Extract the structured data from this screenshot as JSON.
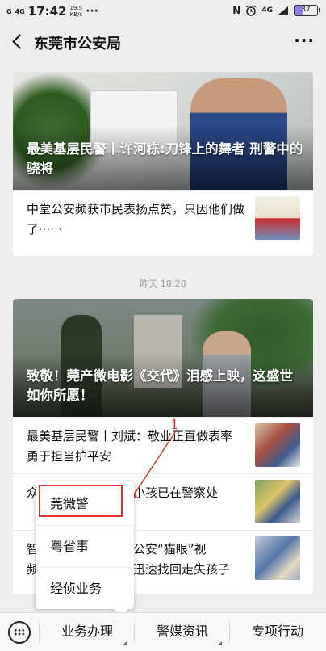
{
  "status_bar": {
    "signal1": "G",
    "signal2": "4G",
    "time": "17:42",
    "speed_value": "19.5",
    "speed_unit": "KB/s",
    "dots": "···",
    "nfc": "N",
    "network": "4G",
    "battery": "37",
    "battery_level": 0.37
  },
  "nav": {
    "title": "东莞市公安局",
    "more": "···"
  },
  "feed": [
    {
      "hero_title": "最美基层民警丨许河栋:刀锋上的舞者 刑警中的骁将",
      "rows": [
        {
          "text": "中堂公安频获市民表扬点赞，只因他们做了······"
        }
      ]
    },
    {
      "timestamp": "昨天 18:28",
      "hero_title": "致敬！莞产微电影《交代》泪感上映，这盛世如你所愿！",
      "rows": [
        {
          "text": "最美基层民警丨刘斌：敬业正直做表率 勇于担当护平安"
        },
        {
          "text": "众",
          "text_right": "小孩已在警察处"
        },
        {
          "text": "智",
          "text2": "频",
          "text_right": "公安“猫眼”视",
          "text_right2": "迅速找回走失孩子"
        }
      ]
    }
  ],
  "annotation": {
    "number": "1",
    "color": "#e0302c"
  },
  "popup_menu": {
    "items": [
      "莞微警",
      "粤省事",
      "经侦业务"
    ]
  },
  "menu_bar": {
    "tabs": [
      "业务办理",
      "警媒资讯",
      "专项行动"
    ]
  }
}
